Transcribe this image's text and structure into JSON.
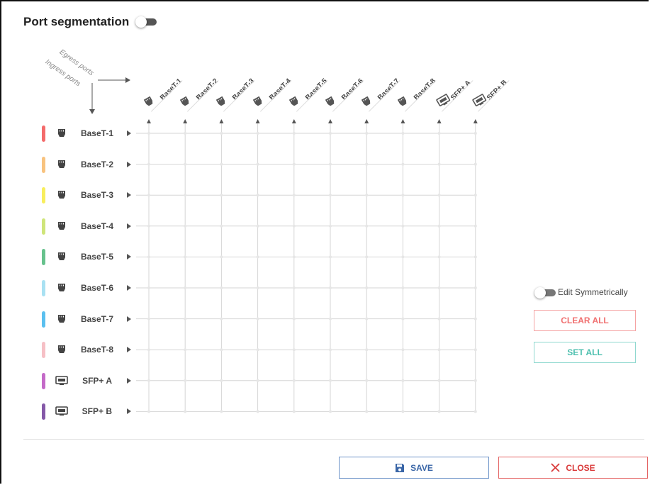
{
  "header": {
    "title": "Port segmentation",
    "toggle_on": false
  },
  "axis_labels": {
    "egress": "Egress ports",
    "ingress": "Ingress ports"
  },
  "ports": [
    {
      "label": "BaseT-1",
      "type": "rj45",
      "color": "#f46b6b"
    },
    {
      "label": "BaseT-2",
      "type": "rj45",
      "color": "#f8c37f"
    },
    {
      "label": "BaseT-3",
      "type": "rj45",
      "color": "#f8ee5d"
    },
    {
      "label": "BaseT-4",
      "type": "rj45",
      "color": "#cfe57a"
    },
    {
      "label": "BaseT-5",
      "type": "rj45",
      "color": "#67c28d"
    },
    {
      "label": "BaseT-6",
      "type": "rj45",
      "color": "#a9e1f2"
    },
    {
      "label": "BaseT-7",
      "type": "rj45",
      "color": "#5bc0ef"
    },
    {
      "label": "BaseT-8",
      "type": "rj45",
      "color": "#f6c0c6"
    },
    {
      "label": "SFP+ A",
      "type": "sfp",
      "color": "#c46ac8"
    },
    {
      "label": "SFP+ B",
      "type": "sfp",
      "color": "#8559a8"
    }
  ],
  "controls": {
    "edit_symmetrically_label": "Edit Symmetrically",
    "edit_symmetrically_on": false,
    "clear_all_label": "CLEAR ALL",
    "set_all_label": "SET ALL"
  },
  "footer": {
    "save_label": "SAVE",
    "close_label": "CLOSE"
  },
  "icons": {
    "rj45": "ethernet-port-icon",
    "sfp": "sfp-port-icon",
    "save": "floppy-disk-icon",
    "close": "close-x-icon"
  }
}
